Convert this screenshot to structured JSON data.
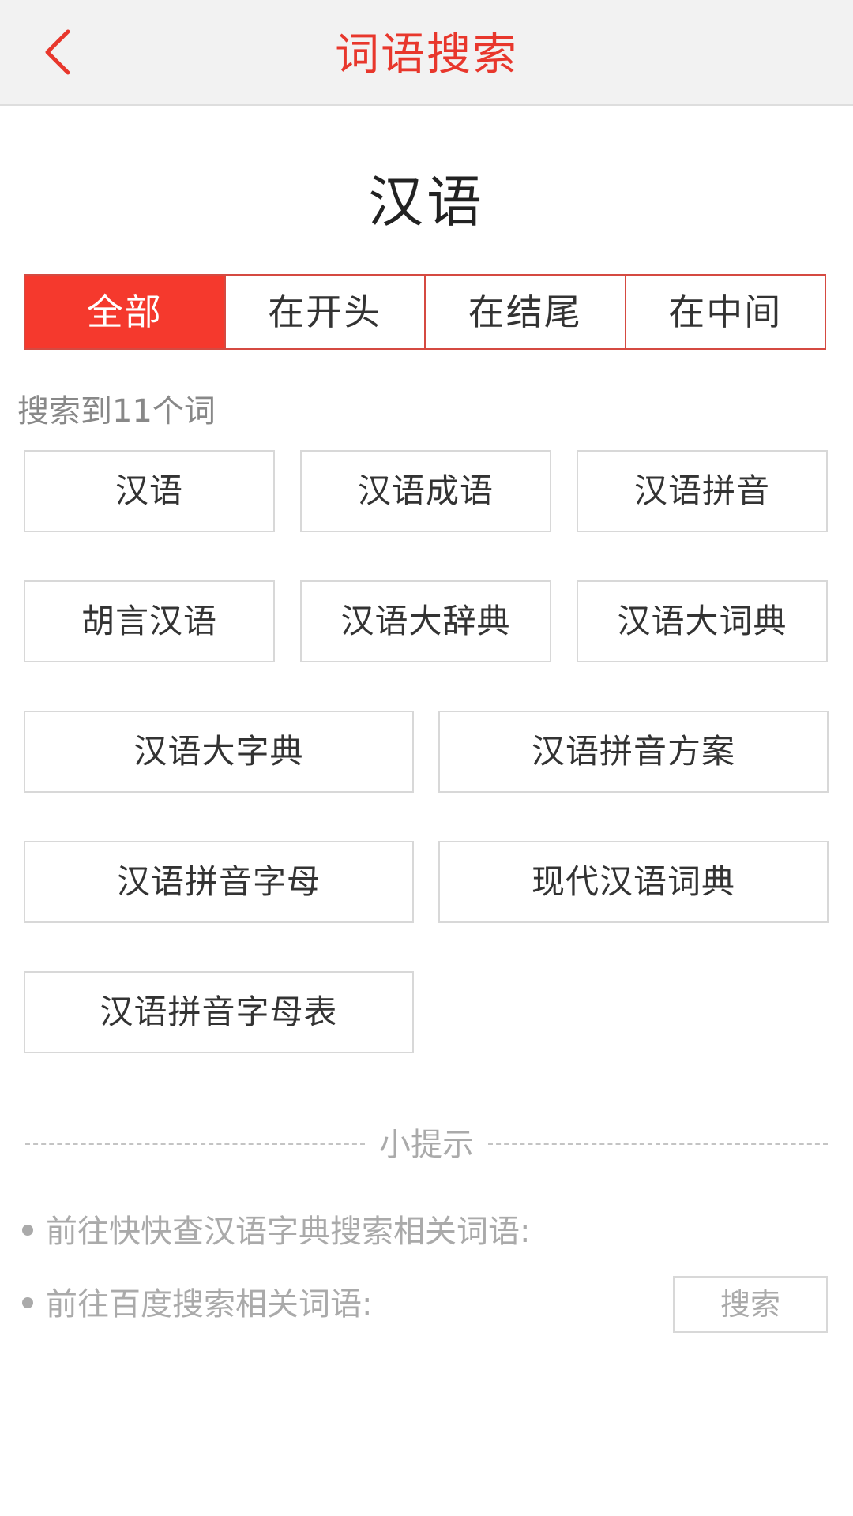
{
  "header": {
    "title": "词语搜索",
    "back_icon": "chevron-left-icon",
    "accent_color": "#e8372c"
  },
  "keyword": "汉语",
  "tabs": [
    {
      "label": "全部",
      "active": true
    },
    {
      "label": "在开头",
      "active": false
    },
    {
      "label": "在结尾",
      "active": false
    },
    {
      "label": "在中间",
      "active": false
    }
  ],
  "result_count_text": "搜索到11个词",
  "words": [
    "汉语",
    "汉语成语",
    "汉语拼音",
    "胡言汉语",
    "汉语大辞典",
    "汉语大词典",
    "汉语大字典",
    "汉语拼音方案",
    "汉语拼音字母",
    "现代汉语词典",
    "汉语拼音字母表"
  ],
  "tips": {
    "title": "小提示",
    "items": [
      {
        "text": "前往快快查汉语字典搜索相关词语:"
      },
      {
        "text": "前往百度搜索相关词语:",
        "button_label": "搜索"
      }
    ]
  },
  "colors": {
    "active_tab_bg": "#f5392d",
    "tab_border": "#d54a41",
    "word_border": "#d8d8d8"
  }
}
